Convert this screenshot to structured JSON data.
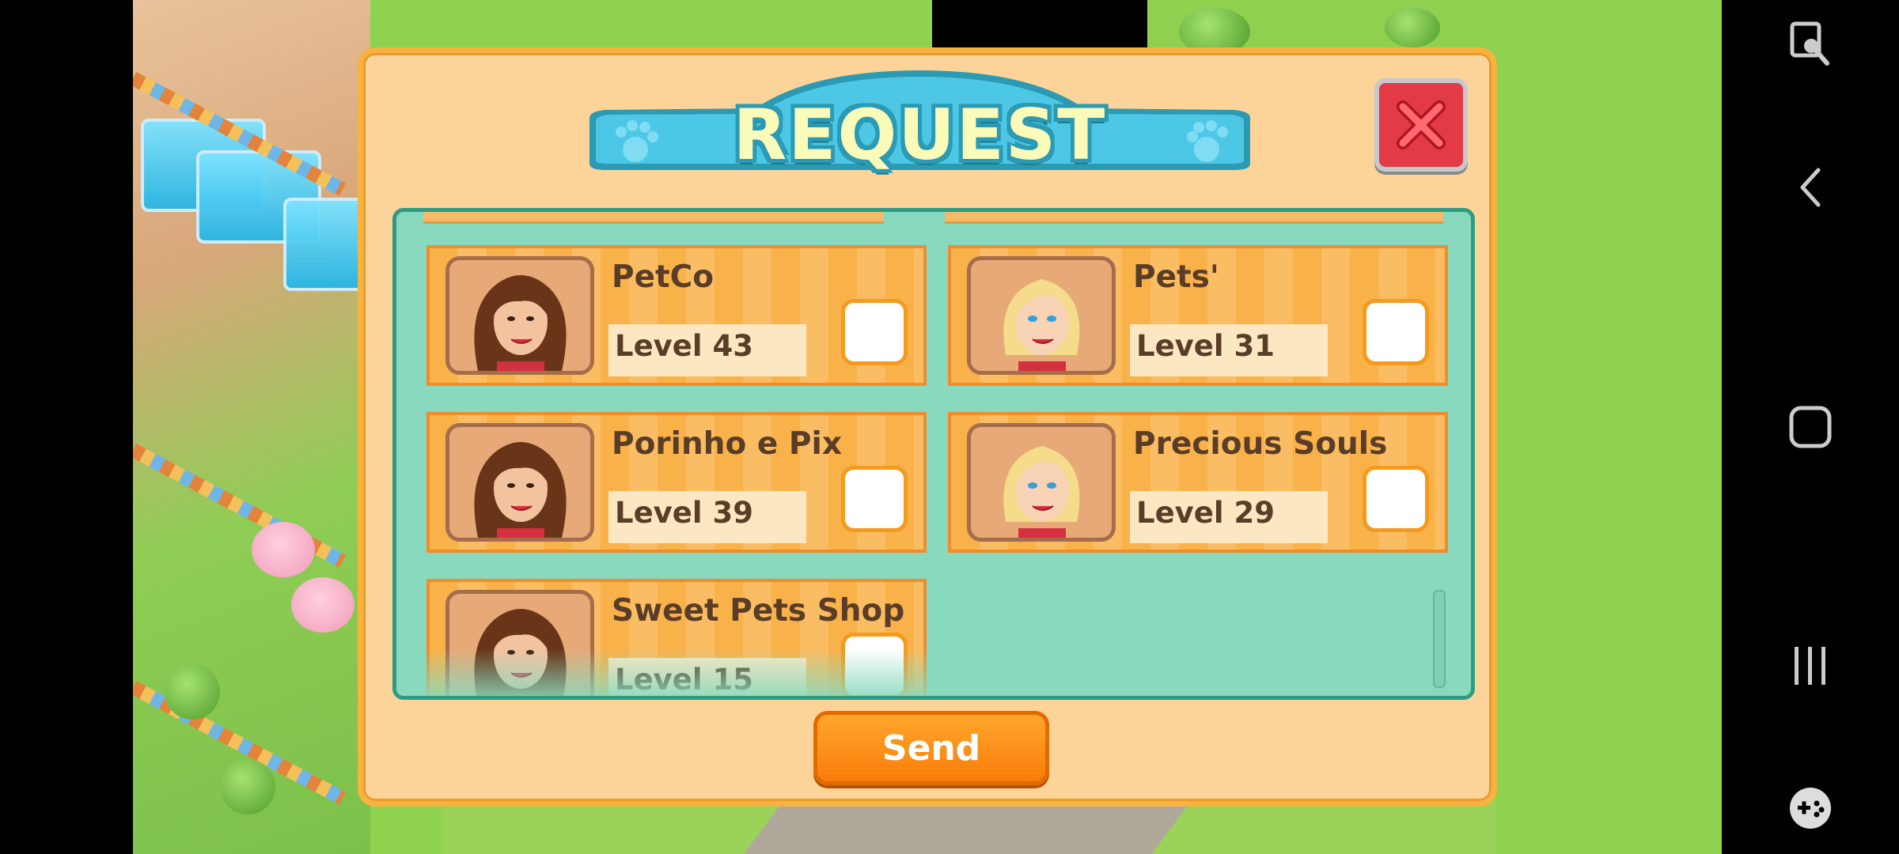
{
  "dialog": {
    "title": "REQUEST",
    "close_icon": "close-x-icon",
    "send_label": "Send"
  },
  "friends": [
    {
      "name": "PetCo",
      "level": "Level 43",
      "checked": false,
      "avatar": "brunette-woman"
    },
    {
      "name": "Pets'",
      "level": "Level 31",
      "checked": false,
      "avatar": "blonde-woman"
    },
    {
      "name": "Porinho e Pix",
      "level": "Level 39",
      "checked": false,
      "avatar": "brunette-woman"
    },
    {
      "name": "Precious Souls",
      "level": "Level 29",
      "checked": false,
      "avatar": "blonde-woman"
    },
    {
      "name": "Sweet Pets Shop",
      "level": "Level 15",
      "checked": false,
      "avatar": "brunette-woman"
    }
  ],
  "colors": {
    "dialog_bg": "#fcd49a",
    "banner": "#4cc8e6",
    "title_text": "#fbfbb9",
    "close": "#e23b45",
    "panel": "#88d9bd",
    "card": "#f9b14a",
    "send": "#f97d0a"
  },
  "nav": {
    "icons": [
      "screen-lock-icon",
      "back-icon",
      "home-icon",
      "recent-apps-icon",
      "game-tools-icon"
    ]
  }
}
